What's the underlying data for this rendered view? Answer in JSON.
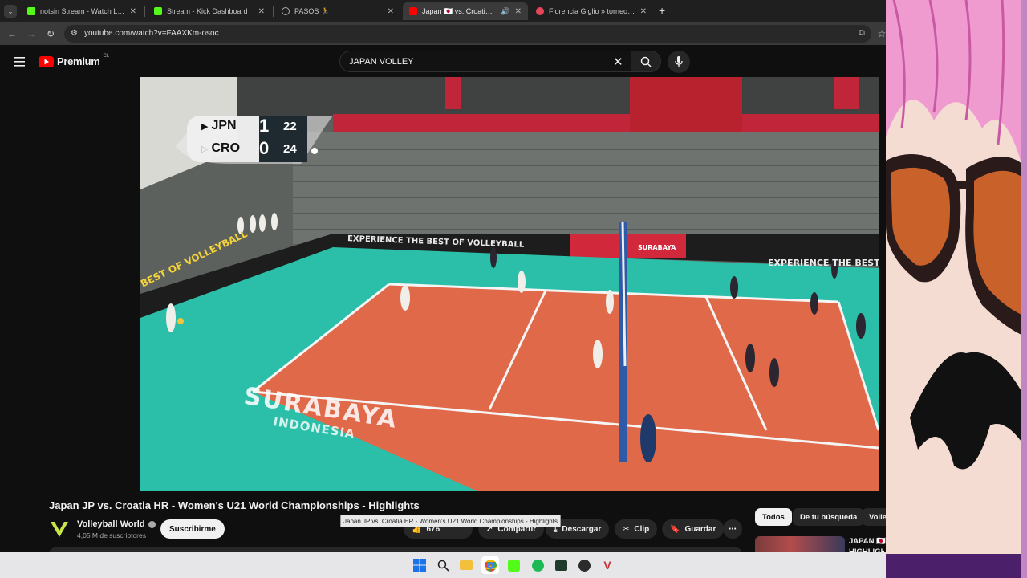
{
  "browser": {
    "tabs": [
      {
        "title": "notsin Stream - Watch Live on K",
        "favicon_color": "#53fc18"
      },
      {
        "title": "Stream - Kick Dashboard",
        "favicon_color": "#53fc18"
      },
      {
        "title": "PASOS 🏃",
        "favicon_color": "#9aa0a6"
      },
      {
        "title": "Japan 🇯🇵 vs. Croatia 🇭🇷 - Wo",
        "favicon_color": "#ff0000",
        "active": true
      },
      {
        "title": "Florencia Giglio » torneos de ir",
        "favicon_color": "#e8455b"
      }
    ],
    "url": "youtube.com/watch?v=FAAXKm-osoc"
  },
  "youtube": {
    "brand": "Premium",
    "country": "CL",
    "search_value": "JAPAN VOLLEY"
  },
  "scoreboard": {
    "team1": "JPN",
    "team1_sets": "1",
    "team1_points": "22",
    "team2": "CRO",
    "team2_sets": "0",
    "team2_points": "24"
  },
  "court_text": {
    "city": "SURABAYA",
    "country": "INDONESIA",
    "banner1": "EXPERIENCE THE BEST OF VOLLEYBALL",
    "banner2": "EXPERIENCE THE BEST",
    "side_banner": "BEST OF VOLLEYBALL",
    "stand_banner": "SURABAYA"
  },
  "video": {
    "title": "Japan JP vs. Croatia HR - Women's U21 World Championships - Highlights",
    "tooltip": "Japan JP vs. Croatia HR - Women's U21 World Championships - Highlights",
    "channel": "Volleyball World",
    "subscribers": "4,05 M de suscriptores",
    "subscribe_label": "Suscribirme",
    "likes": "676",
    "share_label": "Compartir",
    "download_label": "Descargar",
    "clip_label": "Clip",
    "save_label": "Guardar"
  },
  "sidebar": {
    "chips": [
      "Todos",
      "De tu búsqueda",
      "Volle"
    ],
    "next_title_line1": "JAPAN 🇯🇵",
    "next_title_line2": "HIGHLIGH"
  },
  "colors": {
    "court_orange": "#e0694a",
    "court_teal": "#2bbfa9",
    "youtube_red": "#ff0000",
    "kick_green": "#53fc18"
  }
}
